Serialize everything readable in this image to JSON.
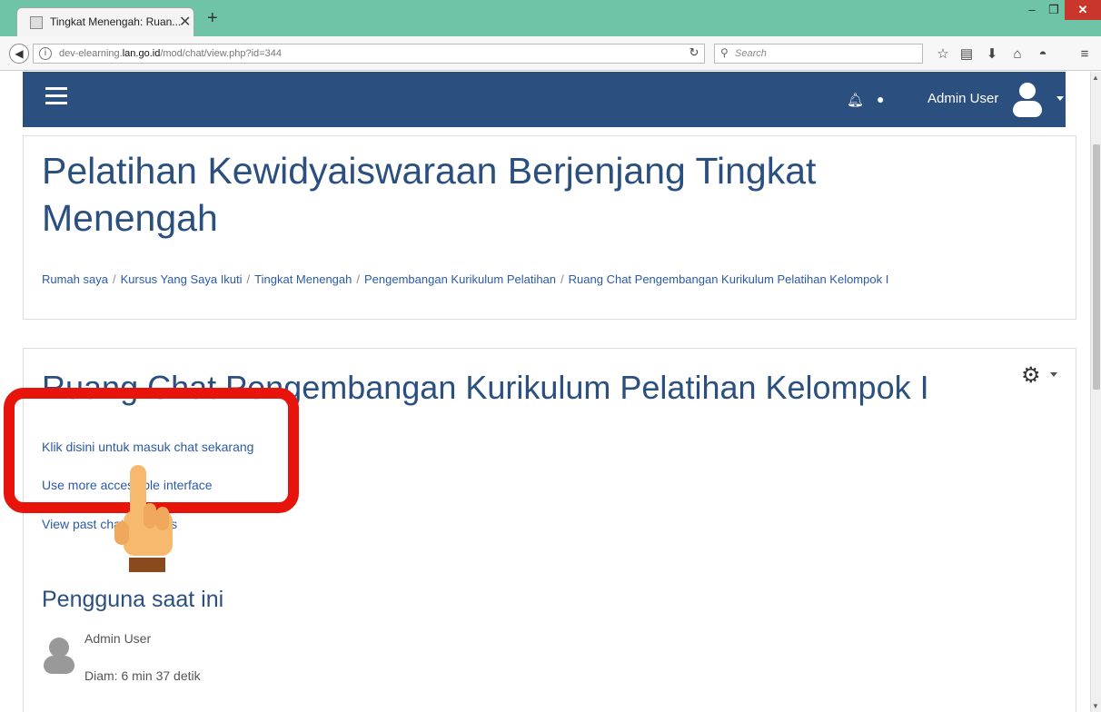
{
  "browser": {
    "tab_title": "Tingkat Menengah: Ruan...",
    "url_prefix": "dev-elearning.",
    "url_domain": "lan.go.id",
    "url_path": "/mod/chat/view.php?id=344",
    "search_placeholder": "Search"
  },
  "header": {
    "user_name": "Admin User"
  },
  "page": {
    "course_title": "Pelatihan Kewidyaiswaraan Berjenjang Tingkat Menengah",
    "breadcrumb": [
      "Rumah saya",
      "Kursus Yang Saya Ikuti",
      "Tingkat Menengah",
      "Pengembangan Kurikulum Pelatihan",
      "Ruang Chat Pengembangan Kurikulum Pelatihan Kelompok I"
    ]
  },
  "activity": {
    "title": "Ruang Chat Pengembangan Kurikulum Pelatihan Kelompok I",
    "enter_chat_link": "Klik disini untuk masuk chat sekarang",
    "accessible_link": "Use more accessible interface",
    "past_sessions_link": "View past chat sessions",
    "current_users_heading": "Pengguna saat ini",
    "current_user_name": "Admin User",
    "current_user_idle": "Diam: 6 min 37 detik"
  },
  "colors": {
    "header_bg": "#2b4f7e",
    "heading_text": "#2b4f7e",
    "link": "#2b5aa8",
    "highlight": "#e8140c",
    "browser_titlebar": "#6fc3a6"
  }
}
